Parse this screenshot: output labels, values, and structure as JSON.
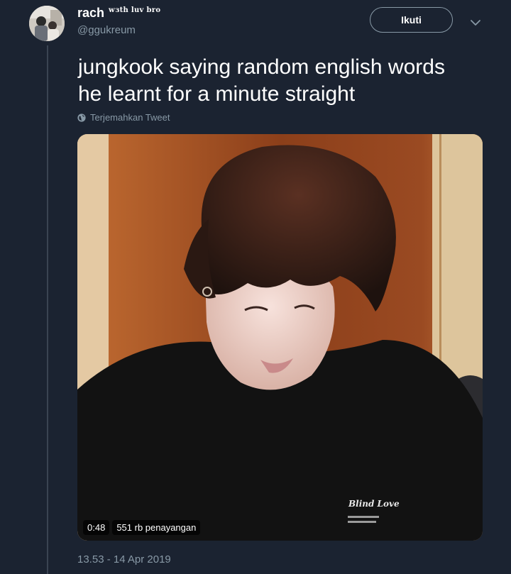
{
  "user": {
    "display_name": "rach",
    "name_suffix": "wзth luv bro",
    "handle": "@ggukreum"
  },
  "follow_button_label": "Ikuti",
  "tweet": {
    "text_lines": [
      "jungkook saying random english words",
      "he learnt for a minute straight"
    ],
    "translate_label": "Terjemahkan Tweet",
    "timestamp": "13.53 - 14 Apr 2019"
  },
  "video": {
    "duration": "0:48",
    "views": "551 rb penayangan",
    "shirt_print": "Blind Love"
  },
  "icons": {
    "more": "chevron-down-icon",
    "translate": "globe-icon"
  },
  "colors": {
    "background": "#1b2331",
    "secondary_text": "#8899a6",
    "primary_text": "#ffffff"
  }
}
